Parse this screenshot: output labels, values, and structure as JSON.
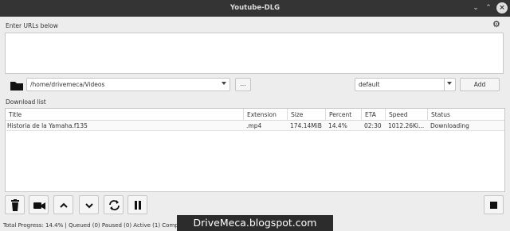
{
  "window": {
    "title": "Youtube-DLG",
    "minimize_glyph": "⌄",
    "maximize_glyph": "⌃",
    "close_glyph": "×"
  },
  "urls": {
    "label": "Enter URLs below",
    "value": ""
  },
  "options": {
    "path": "/home/drivemeca/Videos",
    "browse_label": "...",
    "format": "default",
    "add_label": "Add"
  },
  "download_list": {
    "label": "Download list",
    "columns": [
      "Title",
      "Extension",
      "Size",
      "Percent",
      "ETA",
      "Speed",
      "Status"
    ],
    "rows": [
      {
        "title": "Historia de la Yamaha.f135",
        "extension": ".mp4",
        "size": "174.14MiB",
        "percent": "14.4%",
        "eta": "02:30",
        "speed": "1012.26Ki...",
        "status": "Downloading"
      }
    ]
  },
  "toolbar": {
    "icons": [
      "trash-icon",
      "video-camera-icon",
      "chevron-up-icon",
      "chevron-down-icon",
      "reload-icon",
      "pause-icon",
      "stop-icon"
    ]
  },
  "status_bar": {
    "text": "Total Progress: 14.4% | Queued (0) Paused (0) Active (1) Completed (0) Error (0)"
  },
  "watermark": {
    "text": "DriveMeca.blogspot.com"
  }
}
